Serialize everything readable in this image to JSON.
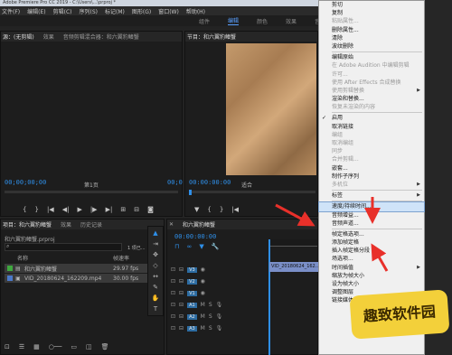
{
  "app": {
    "title": "Adobe Premiere Pro CC 2019 - C:\\Users\\...\\prproj *"
  },
  "menubar": [
    "文件(F)",
    "编辑(E)",
    "剪辑(C)",
    "序列(S)",
    "标记(M)",
    "图形(G)",
    "窗口(W)",
    "帮助(H)"
  ],
  "workspaces": {
    "items": [
      "组件",
      "编辑",
      "颜色",
      "效果",
      "音频"
    ],
    "active": "编辑"
  },
  "source_panel": {
    "tabs": [
      "源：(无剪辑)",
      "效果",
      "音频剪辑混合器：和六翼豹鳍蟹",
      "元数据"
    ],
    "timecode": "00;00;00;00",
    "page": "第1页",
    "timecode_right": "00;0"
  },
  "program_panel": {
    "tab": "节目：和六翼豹鳍蟹",
    "timecode": "00:00:00:00",
    "fit": "适合"
  },
  "project_panel": {
    "tabs": [
      "项目：和六翼豹鳍蟹",
      "效果",
      "历史记录"
    ],
    "file": "和六翼豹鳍蟹.prproj",
    "count": "1 项已...",
    "columns": [
      "名称",
      "帧速率"
    ],
    "items": [
      {
        "name": "和六翼豹鳍蟹",
        "rate": "29.97 fps",
        "color": "#3fa83f"
      },
      {
        "name": "VID_20180624_162209.mp4",
        "rate": "30.00 fps",
        "color": "#4a78c8"
      }
    ]
  },
  "timeline_panel": {
    "tab": "和六翼豹鳍蟹",
    "timecode": "00:00:00:00",
    "tracks": [
      "V3",
      "V2",
      "V1",
      "A1",
      "A2",
      "A3"
    ],
    "clip": "VID_20180624_162..."
  },
  "context_menu": {
    "items": [
      {
        "label": "剪切",
        "enabled": true
      },
      {
        "label": "复制",
        "enabled": true
      },
      {
        "label": "粘贴属性...",
        "enabled": false
      },
      {
        "label": "删除属性...",
        "enabled": true
      },
      {
        "label": "清除",
        "enabled": true
      },
      {
        "label": "波纹删除",
        "enabled": true
      },
      {
        "sep": true
      },
      {
        "label": "编辑原始",
        "enabled": true
      },
      {
        "label": "在 Adobe Audition 中编辑剪辑",
        "enabled": false
      },
      {
        "label": "许可...",
        "enabled": false
      },
      {
        "label": "使用 After Effects 合成替换",
        "enabled": false
      },
      {
        "label": "使用剪辑替换",
        "enabled": false,
        "submenu": true
      },
      {
        "label": "渲染和替换...",
        "enabled": true
      },
      {
        "label": "恢复未渲染的内容",
        "enabled": false
      },
      {
        "sep": true
      },
      {
        "label": "启用",
        "enabled": true,
        "checked": true
      },
      {
        "label": "取消链接",
        "enabled": true
      },
      {
        "label": "编组",
        "enabled": false
      },
      {
        "label": "取消编组",
        "enabled": false
      },
      {
        "label": "同步",
        "enabled": false
      },
      {
        "label": "合并剪辑...",
        "enabled": false
      },
      {
        "label": "嵌套...",
        "enabled": true
      },
      {
        "label": "制作子序列",
        "enabled": true
      },
      {
        "label": "多机位",
        "enabled": false,
        "submenu": true
      },
      {
        "sep": true
      },
      {
        "label": "标签",
        "enabled": true,
        "submenu": true
      },
      {
        "sep": true
      },
      {
        "label": "速度/持续时间...",
        "enabled": true,
        "highlighted": true
      },
      {
        "label": "音频增益...",
        "enabled": true
      },
      {
        "label": "音频声道...",
        "enabled": true
      },
      {
        "sep": true
      },
      {
        "label": "帧定格选项...",
        "enabled": true
      },
      {
        "label": "添加帧定格",
        "enabled": true
      },
      {
        "label": "插入帧定格分段",
        "enabled": true
      },
      {
        "label": "场选项...",
        "enabled": true
      },
      {
        "label": "时间插值",
        "enabled": true,
        "submenu": true
      },
      {
        "label": "缩放为帧大小",
        "enabled": true
      },
      {
        "label": "设为帧大小",
        "enabled": true
      },
      {
        "label": "调整图层",
        "enabled": true
      },
      {
        "label": "链接媒体...",
        "enabled": true
      }
    ]
  },
  "watermark": "趣致软件园",
  "colors": {
    "accent": "#2f8fe8",
    "arrow": "#e8302a",
    "highlight": "#cfe3f8"
  }
}
